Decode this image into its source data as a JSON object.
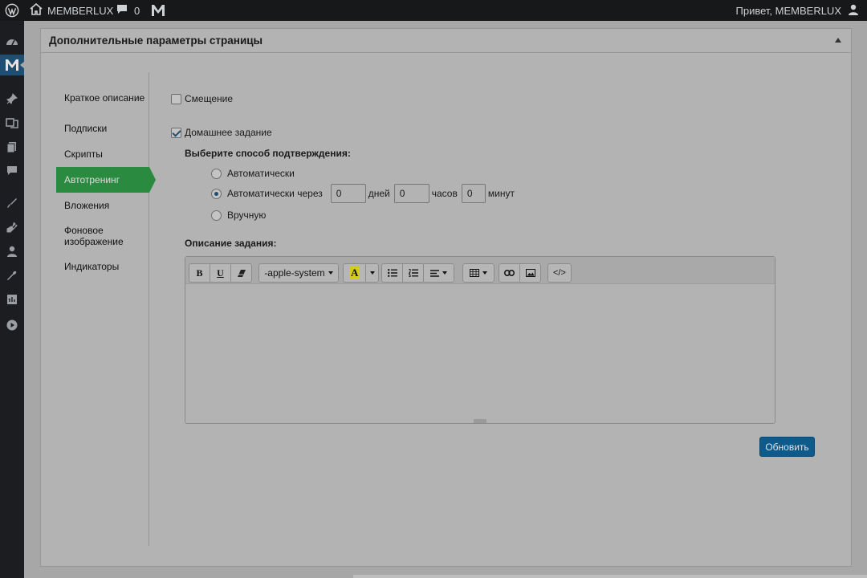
{
  "adminbar": {
    "site_name": "MEMBERLUX",
    "comments_count": "0",
    "greeting": "Привет, MEMBERLUX"
  },
  "adminmenu": {
    "icons": [
      "dashboard-icon",
      "memberlux-icon",
      "pin-icon",
      "media-icon",
      "pages-icon",
      "comments-icon",
      "appearance-icon",
      "plugins-icon",
      "users-icon",
      "tools-icon",
      "settings-icon",
      "play-icon"
    ]
  },
  "postbox": {
    "title": "Дополнительные параметры страницы"
  },
  "tabs": [
    {
      "label": "Краткое описание"
    },
    {
      "label": "Подписки"
    },
    {
      "label": "Скрипты"
    },
    {
      "label": "Автотренинг",
      "active": true
    },
    {
      "label": "Вложения"
    },
    {
      "label": "Фоновое изображение"
    },
    {
      "label": "Индикаторы"
    }
  ],
  "form": {
    "offset_label": "Смещение",
    "offset_checked": false,
    "homework_label": "Домашнее задание",
    "homework_checked": true,
    "confirm_heading": "Выберите способ подтверждения:",
    "radio_auto": "Автоматически",
    "radio_auto_after": "Автоматически через",
    "radio_manual": "Вручную",
    "selected_radio": "radio_auto_after",
    "days_value": "0",
    "days_unit": "дней",
    "hours_value": "0",
    "hours_unit": "часов",
    "minutes_value": "0",
    "minutes_unit": "минут",
    "description_heading": "Описание задания:"
  },
  "editor": {
    "bold": "B",
    "underline": "U",
    "font_family": "-apple-system",
    "color_letter": "A",
    "code_view": "</>"
  },
  "update_button": "Обновить",
  "colors": {
    "active_tab": "#2a8a3f",
    "primary_button": "#0e5a8b",
    "adminbar": "#16181a",
    "highlight_yellow": "#d4cc1a"
  }
}
